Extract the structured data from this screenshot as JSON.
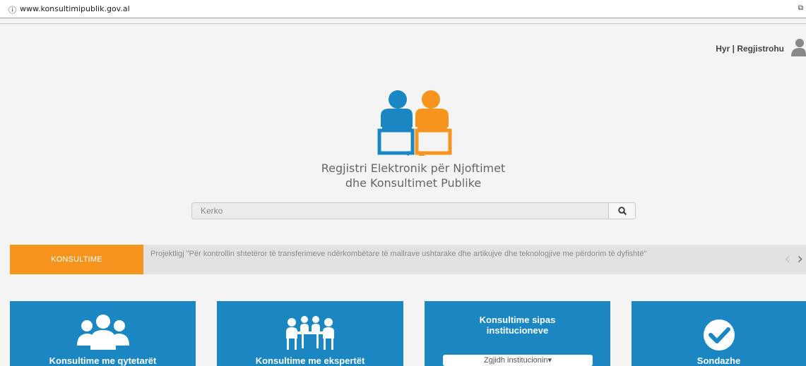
{
  "browser": {
    "info_icon": "info-circle-icon",
    "url": "www.konsultimipublik.gov.al"
  },
  "auth": {
    "login_label": "Hyr",
    "separator": "|",
    "register_label": "Regjistrohu"
  },
  "logo": {
    "line1": "Regjistri Elektronik për Njoftimet",
    "line2": "dhe Konsultimet Publike"
  },
  "search": {
    "placeholder": "Kerko",
    "icon": "search-icon"
  },
  "ticker": {
    "tag_label": "KONSULTIME",
    "text": "Projektligj \"Për kontrollin shtetëror të transferimeve ndërkombëtare të mallrave ushtarake dhe artikujve dhe teknologjive me përdorim të dyfishtë\"",
    "prev": "‹",
    "next": "›"
  },
  "cards": [
    {
      "title": "Konsultime me qytetarët",
      "icon": "citizens-group-icon"
    },
    {
      "title": "Konsultime me ekspertët",
      "icon": "experts-meeting-icon"
    },
    {
      "title_line1": "Konsultime sipas",
      "title_line2": "institucioneve",
      "dropdown_label": "Zgjidh institucionin",
      "dropdown_caret": "▾"
    },
    {
      "title": "Sondazhe",
      "icon": "checkmark-circle-icon"
    }
  ],
  "colors": {
    "accent_blue": "#1a87c3",
    "accent_orange": "#f7941d",
    "background": "#f4f4f4"
  }
}
